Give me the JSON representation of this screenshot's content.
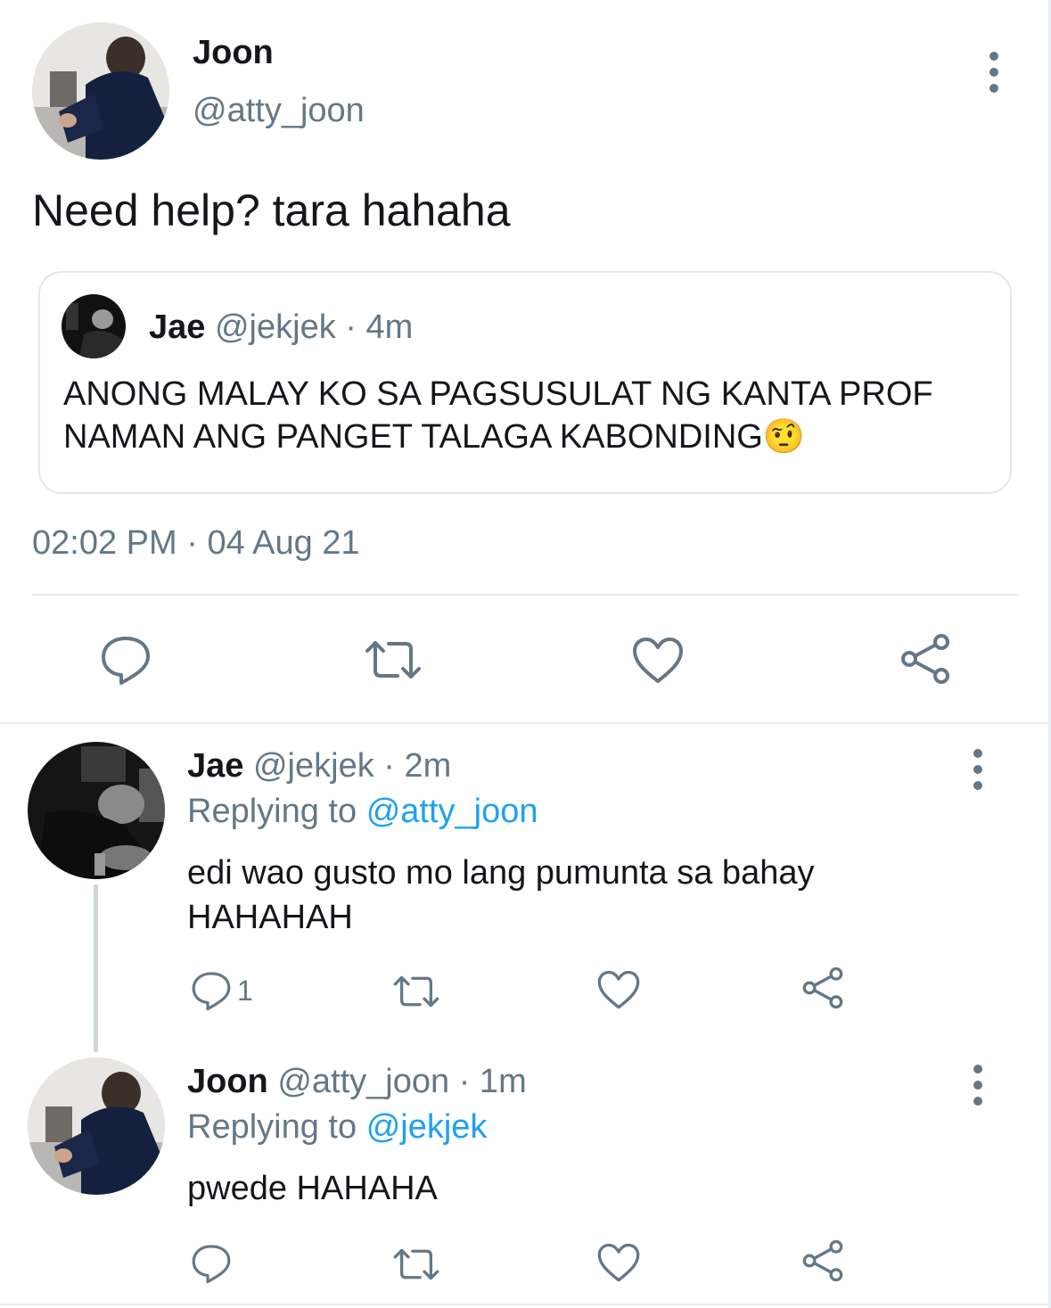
{
  "main_tweet": {
    "author_name": "Joon",
    "author_handle": "@atty_joon",
    "text": "Need help? tara hahaha",
    "timestamp": "02:02 PM",
    "separator": "·",
    "date": "04 Aug 21"
  },
  "quoted_tweet": {
    "author_name": "Jae",
    "author_handle": "@jekjek",
    "time_ago": "· 4m",
    "text": "ANONG MALAY KO SA PAGSUSULAT NG KANTA PROF NAMAN ANG PANGET TALAGA KABONDING",
    "emoji": "🤨"
  },
  "replies": [
    {
      "author_name": "Jae",
      "author_handle": "@jekjek",
      "time_ago": "· 2m",
      "replying_label": "Replying to",
      "replying_to": "@atty_joon",
      "text": "edi wao gusto mo lang pumunta sa bahay HAHAHAH",
      "reply_count": "1"
    },
    {
      "author_name": "Joon",
      "author_handle": "@atty_joon",
      "time_ago": "· 1m",
      "replying_label": "Replying to",
      "replying_to": "@jekjek",
      "text": "pwede HAHAHA",
      "reply_count": ""
    }
  ],
  "icons": {
    "reply": "reply-icon",
    "retweet": "retweet-icon",
    "like": "heart-icon",
    "share": "share-icon",
    "more": "more-vertical-icon"
  },
  "colors": {
    "text": "#14171a",
    "muted": "#657786",
    "link": "#1da1f2",
    "divider": "#e6ecf0"
  }
}
